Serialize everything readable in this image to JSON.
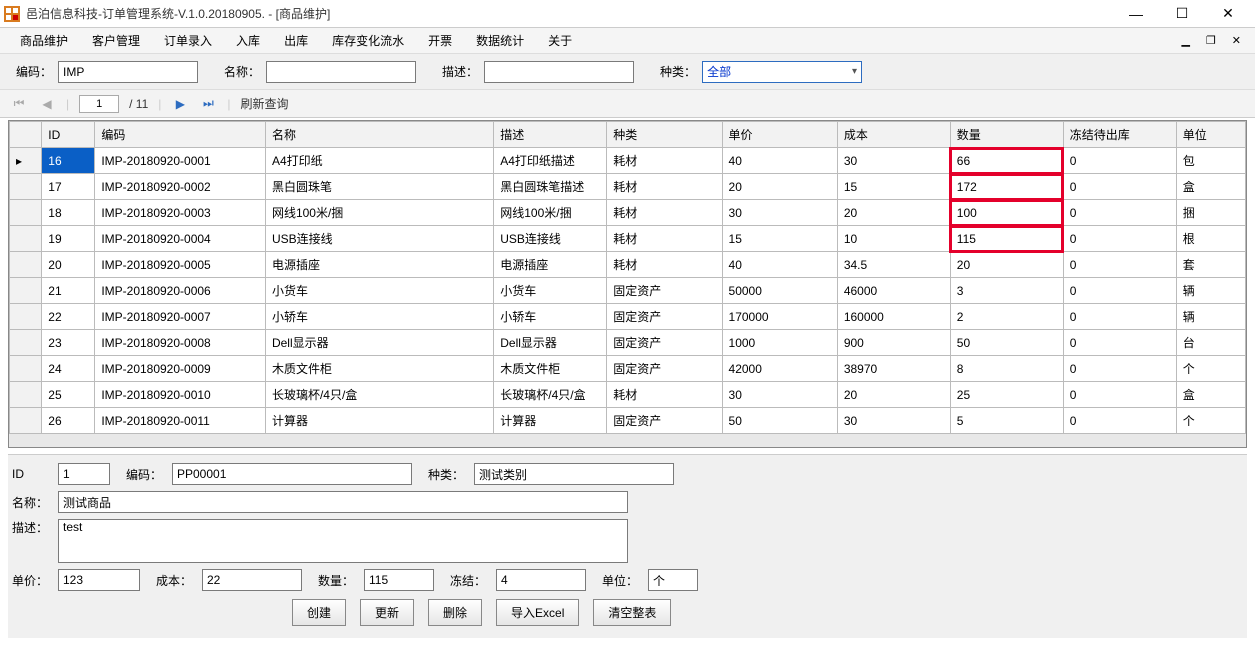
{
  "window": {
    "title": "邑泊信息科技-订单管理系统-V.1.0.20180905. - [商品维护]"
  },
  "menu": {
    "items": [
      "商品维护",
      "客户管理",
      "订单录入",
      "入库",
      "出库",
      "库存变化流水",
      "开票",
      "数据统计",
      "关于"
    ]
  },
  "filter": {
    "code_label": "编码：",
    "code_value": "IMP",
    "name_label": "名称：",
    "name_value": "",
    "desc_label": "描述：",
    "desc_value": "",
    "type_label": "种类：",
    "type_value": "全部"
  },
  "nav": {
    "page": "1",
    "total": "/ 11",
    "refresh": "刷新查询"
  },
  "table": {
    "columns": [
      "ID",
      "编码",
      "名称",
      "描述",
      "种类",
      "单价",
      "成本",
      "数量",
      "冻结待出库",
      "单位"
    ],
    "highlight_column_index": 7,
    "highlight_rows": [
      0,
      1,
      2,
      3
    ],
    "rows": [
      {
        "id": "16",
        "code": "IMP-20180920-0001",
        "name": "A4打印纸",
        "desc": "A4打印纸描述",
        "cat": "耗材",
        "price": "40",
        "cost": "30",
        "qty": "66",
        "freeze": "0",
        "unit": "包",
        "selected": true
      },
      {
        "id": "17",
        "code": "IMP-20180920-0002",
        "name": "黑白圆珠笔",
        "desc": "黑白圆珠笔描述",
        "cat": "耗材",
        "price": "20",
        "cost": "15",
        "qty": "172",
        "freeze": "0",
        "unit": "盒"
      },
      {
        "id": "18",
        "code": "IMP-20180920-0003",
        "name": "网线100米/捆",
        "desc": "网线100米/捆",
        "cat": "耗材",
        "price": "30",
        "cost": "20",
        "qty": "100",
        "freeze": "0",
        "unit": "捆"
      },
      {
        "id": "19",
        "code": "IMP-20180920-0004",
        "name": "USB连接线",
        "desc": "USB连接线",
        "cat": "耗材",
        "price": "15",
        "cost": "10",
        "qty": "115",
        "freeze": "0",
        "unit": "根"
      },
      {
        "id": "20",
        "code": "IMP-20180920-0005",
        "name": "电源插座",
        "desc": "电源插座",
        "cat": "耗材",
        "price": "40",
        "cost": "34.5",
        "qty": "20",
        "freeze": "0",
        "unit": "套"
      },
      {
        "id": "21",
        "code": "IMP-20180920-0006",
        "name": "小货车",
        "desc": "小货车",
        "cat": "固定资产",
        "price": "50000",
        "cost": "46000",
        "qty": "3",
        "freeze": "0",
        "unit": "辆"
      },
      {
        "id": "22",
        "code": "IMP-20180920-0007",
        "name": "小轿车",
        "desc": "小轿车",
        "cat": "固定资产",
        "price": "170000",
        "cost": "160000",
        "qty": "2",
        "freeze": "0",
        "unit": "辆"
      },
      {
        "id": "23",
        "code": "IMP-20180920-0008",
        "name": "Dell显示器",
        "desc": "Dell显示器",
        "cat": "固定资产",
        "price": "1000",
        "cost": "900",
        "qty": "50",
        "freeze": "0",
        "unit": "台"
      },
      {
        "id": "24",
        "code": "IMP-20180920-0009",
        "name": "木质文件柜",
        "desc": "木质文件柜",
        "cat": "固定资产",
        "price": "42000",
        "cost": "38970",
        "qty": "8",
        "freeze": "0",
        "unit": "个"
      },
      {
        "id": "25",
        "code": "IMP-20180920-0010",
        "name": "长玻璃杯/4只/盒",
        "desc": "长玻璃杯/4只/盒",
        "cat": "耗材",
        "price": "30",
        "cost": "20",
        "qty": "25",
        "freeze": "0",
        "unit": "盒"
      },
      {
        "id": "26",
        "code": "IMP-20180920-0011",
        "name": "计算器",
        "desc": "计算器",
        "cat": "固定资产",
        "price": "50",
        "cost": "30",
        "qty": "5",
        "freeze": "0",
        "unit": "个"
      }
    ]
  },
  "detail": {
    "id_label": "ID",
    "id": "1",
    "code_label": "编码：",
    "code": "PP00001",
    "cat_label": "种类：",
    "cat": "测试类别",
    "name_label": "名称：",
    "name": "测试商品",
    "desc_label": "描述：",
    "desc": "test",
    "price_label": "单价：",
    "price": "123",
    "cost_label": "成本：",
    "cost": "22",
    "qty_label": "数量：",
    "qty": "115",
    "freeze_label": "冻结：",
    "freeze": "4",
    "unit_label": "单位：",
    "unit": "个"
  },
  "buttons": {
    "create": "创建",
    "update": "更新",
    "delete": "删除",
    "import": "导入Excel",
    "clear": "清空整表"
  }
}
